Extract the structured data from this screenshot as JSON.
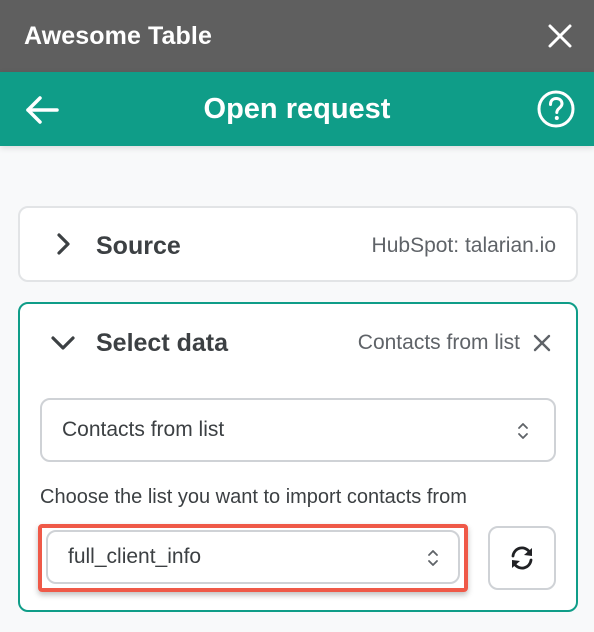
{
  "window": {
    "title": "Awesome Table",
    "close_icon": "close-icon"
  },
  "header": {
    "title": "Open request",
    "back_icon": "arrow-left-icon",
    "help_icon": "help-circle-icon",
    "color": "#0f9d88"
  },
  "source": {
    "title": "Source",
    "value": "HubSpot: talarian.io",
    "expanded": false
  },
  "select_data": {
    "title": "Select data",
    "value": "Contacts from list",
    "expanded": true,
    "type_dropdown": {
      "selected": "Contacts from list"
    },
    "list_label": "Choose the list you want to import contacts from",
    "list_dropdown": {
      "selected": "full_client_info"
    },
    "refresh_icon": "refresh-icon"
  },
  "colors": {
    "titlebar": "#5f5f5f",
    "accent": "#0f9d88",
    "highlight": "#ef5948"
  }
}
